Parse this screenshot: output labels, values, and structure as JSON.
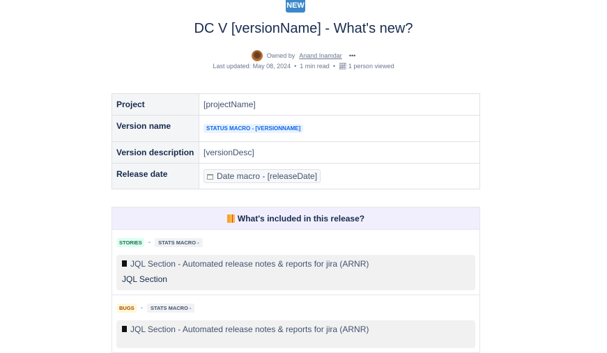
{
  "badge": "NEW",
  "title": "DC V [versionName] - What's new?",
  "owner": {
    "prefix": "Owned by",
    "name": "Anand Inamdar",
    "more": "•••"
  },
  "meta": {
    "updated": "Last updated: May 08, 2024",
    "read": "1 min read",
    "views": "1 person viewed"
  },
  "table": [
    {
      "label": "Project",
      "value": "[projectName]"
    },
    {
      "label": "Version name",
      "value": "STATUS MACRO - [VERSIONNAME]"
    },
    {
      "label": "Version description",
      "value": "[versionDesc]"
    },
    {
      "label": "Release date",
      "value": "Date macro - [releaseDate]"
    }
  ],
  "release": {
    "heading": "What's included in this release?",
    "sections": [
      {
        "tag": "STORIES",
        "dash": "-",
        "stats": "STATS MACRO -",
        "jql_title": "JQL Section - Automated release notes & reports for jira (ARNR)",
        "jql_body": "JQL Section"
      },
      {
        "tag": "BUGS",
        "dash": "-",
        "stats": "STATS MACRO -",
        "jql_title": "JQL Section - Automated release notes & reports for jira (ARNR)"
      }
    ]
  }
}
